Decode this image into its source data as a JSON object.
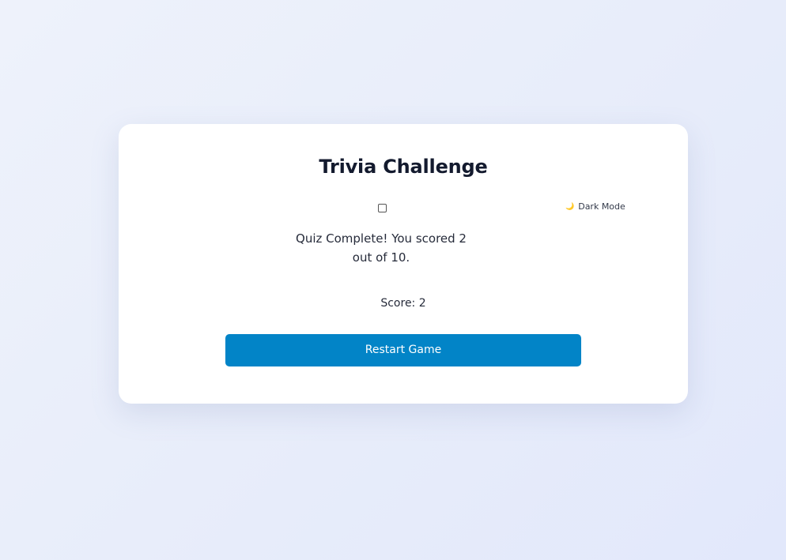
{
  "quiz": {
    "title": "Trivia Challenge",
    "result_message": "Quiz Complete! You scored 2 out of 10.",
    "score_label": "Score: 2",
    "restart_label": "Restart Game"
  },
  "theme_toggle": {
    "checked": false,
    "icon": "moon-icon",
    "icon_glyph": "🌙",
    "label": "Dark Mode"
  },
  "colors": {
    "accent": "#0284c7",
    "title": "#131a2e",
    "background": "#eef2fb"
  }
}
